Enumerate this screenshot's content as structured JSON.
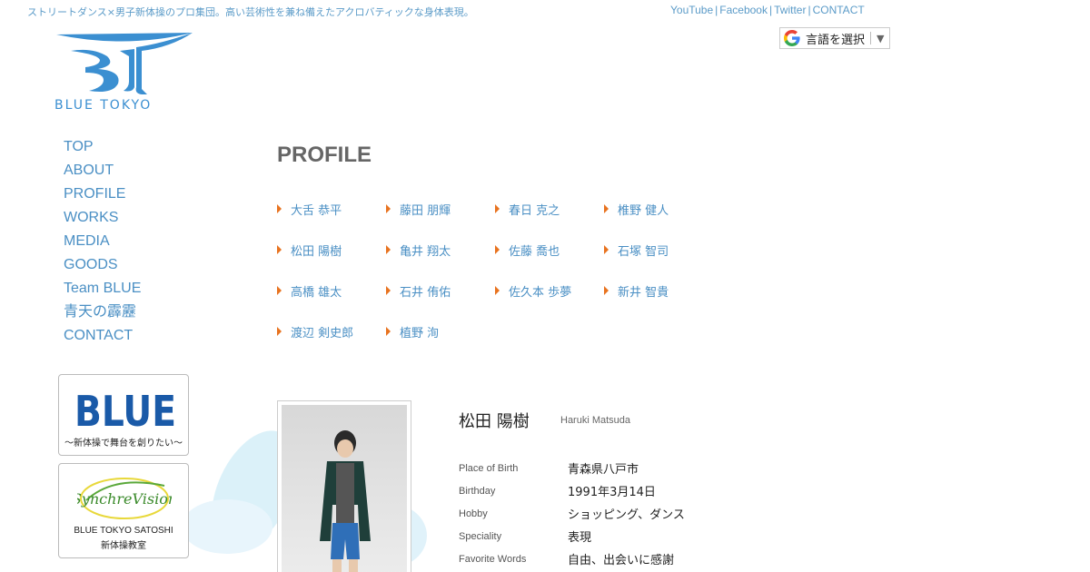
{
  "header": {
    "tagline": "ストリートダンス×男子新体操のプロ集団。高い芸術性を兼ね備えたアクロバティックな身体表現。",
    "links": [
      "YouTube",
      "Facebook",
      "Twitter",
      "CONTACT"
    ],
    "translate_label": "言語を選択",
    "logo_text": "BLUE TOKYO"
  },
  "nav": [
    "TOP",
    "ABOUT",
    "PROFILE",
    "WORKS",
    "MEDIA",
    "GOODS",
    "Team BLUE",
    "青天の霹靂",
    "CONTACT"
  ],
  "banners": {
    "blue": {
      "word": "BLUE",
      "sub": "〜新体操で舞台を創りたい〜"
    },
    "sync": {
      "logo": "SynchreVision",
      "line1": "BLUE TOKYO SATOSHI",
      "line2": "新体操教室"
    }
  },
  "page": {
    "title": "PROFILE"
  },
  "members": [
    "大舌 恭平",
    "藤田 朋輝",
    "春日 克之",
    "椎野 健人",
    "松田 陽樹",
    "亀井 翔太",
    "佐藤 喬也",
    "石塚 智司",
    "高橋 雄太",
    "石井 侑佑",
    "佐久本 歩夢",
    "新井 智貴",
    "渡辺 剣史郎",
    "植野 洵"
  ],
  "profile": {
    "name_jp": "松田 陽樹",
    "name_en": "Haruki Matsuda",
    "fields": [
      {
        "label": "Place of Birth",
        "value": "青森県八戸市"
      },
      {
        "label": "Birthday",
        "value": "1991年3月14日"
      },
      {
        "label": "Hobby",
        "value": "ショッピング、ダンス"
      },
      {
        "label": "Speciality",
        "value": "表現"
      },
      {
        "label": "Favorite Words",
        "value": "自由、出会いに感謝"
      }
    ]
  },
  "colors": {
    "accent": "#4a8fc4",
    "arrow": "#e8731f",
    "logo": "#3b8fd1",
    "blue_banner": "#1a5aa8"
  }
}
